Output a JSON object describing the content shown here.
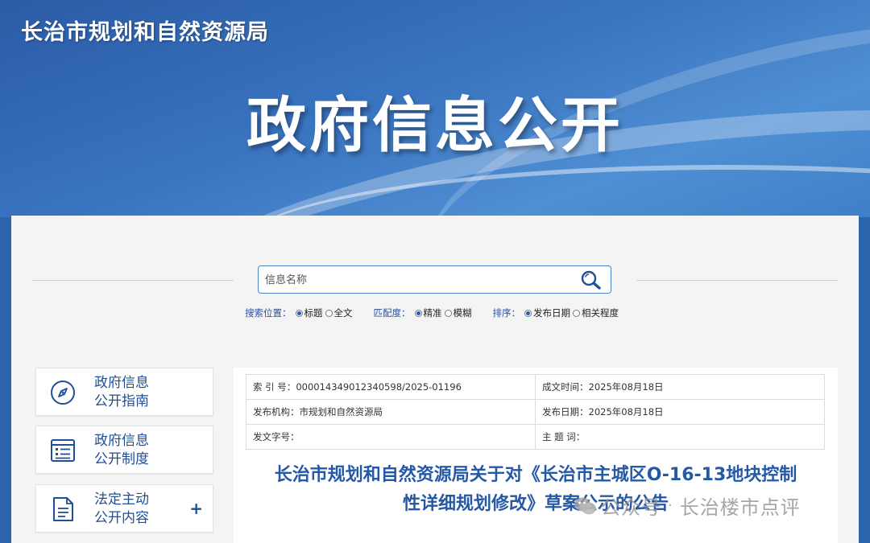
{
  "header": {
    "org_name": "长治市规划和自然资源局",
    "banner_title": "政府信息公开"
  },
  "search": {
    "placeholder": "信息名称",
    "icon": "search-icon",
    "scope_label": "搜索位置：",
    "scope_options": [
      "标题",
      "全文"
    ],
    "scope_selected": "标题",
    "match_label": "匹配度：",
    "match_options": [
      "精准",
      "模糊"
    ],
    "match_selected": "精准",
    "sort_label": "排序：",
    "sort_options": [
      "发布日期",
      "相关程度"
    ],
    "sort_selected": "发布日期"
  },
  "sidebar": {
    "items": [
      {
        "label_line1": "政府信息",
        "label_line2": "公开指南",
        "icon": "compass-icon"
      },
      {
        "label_line1": "政府信息",
        "label_line2": "公开制度",
        "icon": "document-list-icon"
      },
      {
        "label_line1": "法定主动",
        "label_line2": "公开内容",
        "icon": "document-icon",
        "expand": "+"
      }
    ]
  },
  "meta": {
    "index_label": "索  引 号：",
    "index_value": "000014349012340598/2025-01196",
    "created_label": "成文时间：",
    "created_value": "2025年08月18日",
    "publisher_label": "发布机构：",
    "publisher_value": "市规划和自然资源局",
    "publish_date_label": "发布日期：",
    "publish_date_value": "2025年08月18日",
    "doc_no_label": "发文字号：",
    "doc_no_value": "",
    "keywords_label": "主  题  词：",
    "keywords_value": ""
  },
  "document": {
    "title_line1": "长治市规划和自然资源局关于对《长治市主城区O-16-13地块控制",
    "title_line2": "性详细规划修改》草案公示的公告"
  },
  "watermark": {
    "prefix": "公众号",
    "separator": "·",
    "account": "长治楼市点评"
  },
  "colors": {
    "banner_blue": "#2d62ad",
    "title_blue": "#2558a5",
    "link_blue": "#1f4f96"
  }
}
